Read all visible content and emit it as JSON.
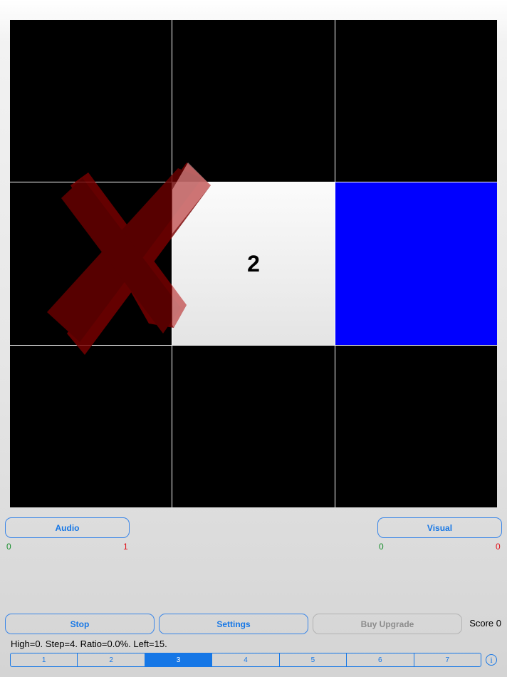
{
  "grid": {
    "rows": 3,
    "cols": 3,
    "lit_cell_number": "2",
    "colors": {
      "off": "#000000",
      "lit": "#eeeeee",
      "highlight": "#0000ff",
      "cross": "#6b0000"
    }
  },
  "controls": {
    "audio_label": "Audio",
    "visual_label": "Visual",
    "audio_correct": "0",
    "audio_wrong": "1",
    "visual_correct": "0",
    "visual_wrong": "0"
  },
  "toolbar": {
    "stop_label": "Stop",
    "settings_label": "Settings",
    "upgrade_label": "Buy Upgrade",
    "score_text": "Score 0"
  },
  "status_text": "High=0. Step=4. Ratio=0.0%. Left=15.",
  "levels": [
    "1",
    "2",
    "3",
    "4",
    "5",
    "6",
    "7"
  ],
  "selected_level": "3",
  "icons": {
    "wrong": "cross-icon",
    "info": "info-icon"
  },
  "accent_color": "#1677e6"
}
